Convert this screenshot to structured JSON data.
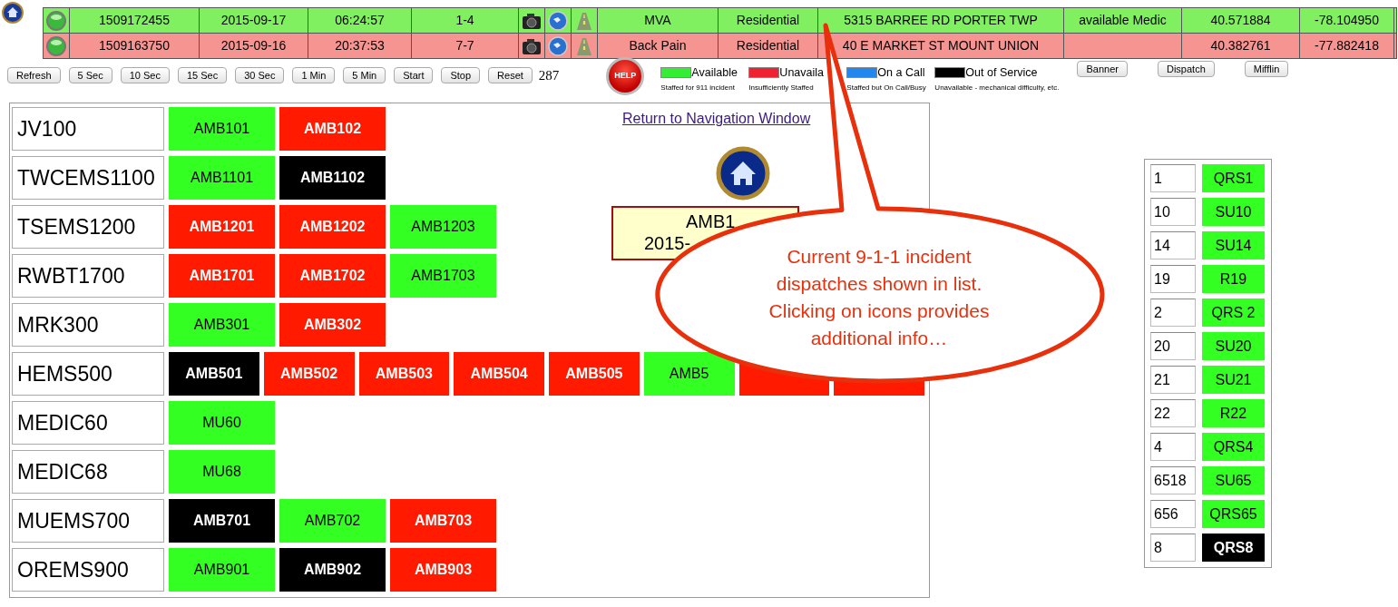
{
  "incidents": [
    {
      "id": "1509172455",
      "date": "2015-09-17",
      "time": "06:24:57",
      "code": "1-4",
      "type": "MVA",
      "category": "Residential",
      "address": "5315 BARREE RD PORTER TWP",
      "status": "available Medic",
      "latitude": "40.571884",
      "longitude": "-78.104950",
      "color": "#80f060"
    },
    {
      "id": "1509163750",
      "date": "2015-09-16",
      "time": "20:37:53",
      "code": "7-7",
      "type": "Back Pain",
      "category": "Residential",
      "address": "40 E MARKET ST MOUNT UNION",
      "latitude": "40.382761",
      "longitude": "-77.882418",
      "color": "#f59490"
    }
  ],
  "refresh_buttons": [
    "Refresh",
    "5 Sec",
    "10 Sec",
    "15 Sec",
    "30 Sec",
    "1 Min",
    "5 Min",
    "Start",
    "Stop",
    "Reset"
  ],
  "counter": "287",
  "help_button": "HELP",
  "legend": [
    {
      "label": "Available",
      "caption": "Staffed for 911 incident",
      "color": "#33ee33"
    },
    {
      "label": "Unavaila",
      "caption": "Insufficiently Staffed",
      "color": "#ee2233"
    },
    {
      "label": "On a Call",
      "caption": "Staffed but On Call/Busy",
      "color": "#2288ee"
    },
    {
      "label": "Out of Service",
      "caption": "Unavailable - mechanical difficulty, etc.",
      "color": "#000000"
    }
  ],
  "page_buttons": [
    "Banner",
    "Dispatch",
    "Mifflin"
  ],
  "nav_link": "Return to Navigation Window",
  "selected_unit": {
    "lines": [
      "AMB1",
      "2015-"
    ]
  },
  "agencies": [
    {
      "name": "JV100",
      "units": [
        {
          "label": "AMB101",
          "color": "#33ff22"
        },
        {
          "label": "AMB102",
          "color": "#ff1a00"
        }
      ]
    },
    {
      "name": "TWCEMS1100",
      "units": [
        {
          "label": "AMB1101",
          "color": "#33ff22"
        },
        {
          "label": "AMB1102",
          "color": "#000000"
        }
      ]
    },
    {
      "name": "TSEMS1200",
      "units": [
        {
          "label": "AMB1201",
          "color": "#ff1a00"
        },
        {
          "label": "AMB1202",
          "color": "#ff1a00"
        },
        {
          "label": "AMB1203",
          "color": "#33ff22"
        }
      ]
    },
    {
      "name": "RWBT1700",
      "units": [
        {
          "label": "AMB1701",
          "color": "#ff1a00"
        },
        {
          "label": "AMB1702",
          "color": "#ff1a00"
        },
        {
          "label": "AMB1703",
          "color": "#33ff22"
        }
      ]
    },
    {
      "name": "MRK300",
      "units": [
        {
          "label": "AMB301",
          "color": "#33ff22"
        },
        {
          "label": "AMB302",
          "color": "#ff1a00"
        }
      ]
    },
    {
      "name": "HEMS500",
      "units": [
        {
          "label": "AMB501",
          "color": "#000000"
        },
        {
          "label": "AMB502",
          "color": "#ff1a00"
        },
        {
          "label": "AMB503",
          "color": "#ff1a00"
        },
        {
          "label": "AMB504",
          "color": "#ff1a00"
        },
        {
          "label": "AMB505",
          "color": "#ff1a00"
        },
        {
          "label": "AMB5",
          "color": "#33ff22"
        },
        {
          "color": "#ff1a00"
        },
        {
          "color": "#ff1a00"
        }
      ]
    },
    {
      "name": "MEDIC60",
      "units": [
        {
          "label": "MU60",
          "color": "#33ff22"
        }
      ]
    },
    {
      "name": "MEDIC68",
      "units": [
        {
          "label": "MU68",
          "color": "#33ff22"
        }
      ]
    },
    {
      "name": "MUEMS700",
      "units": [
        {
          "label": "AMB701",
          "color": "#000000"
        },
        {
          "label": "AMB702",
          "color": "#33ff22"
        },
        {
          "label": "AMB703",
          "color": "#ff1a00"
        }
      ]
    },
    {
      "name": "OREMS900",
      "units": [
        {
          "label": "AMB901",
          "color": "#33ff22"
        },
        {
          "label": "AMB902",
          "color": "#000000"
        },
        {
          "label": "AMB903",
          "color": "#ff1a00"
        }
      ]
    }
  ],
  "quick_response": [
    {
      "number": "1",
      "unit": "QRS1",
      "color": "#33ff22"
    },
    {
      "number": "10",
      "unit": "SU10",
      "color": "#33ff22"
    },
    {
      "number": "14",
      "unit": "SU14",
      "color": "#33ff22"
    },
    {
      "number": "19",
      "unit": "R19",
      "color": "#33ff22"
    },
    {
      "number": "2",
      "unit": "QRS 2",
      "color": "#33ff22"
    },
    {
      "number": "20",
      "unit": "SU20",
      "color": "#33ff22"
    },
    {
      "number": "21",
      "unit": "SU21",
      "color": "#33ff22"
    },
    {
      "number": "22",
      "unit": "R22",
      "color": "#33ff22"
    },
    {
      "number": "4",
      "unit": "QRS4",
      "color": "#33ff22"
    },
    {
      "number": "6518",
      "unit": "SU65",
      "color": "#33ff22"
    },
    {
      "number": "656",
      "unit": "QRS65",
      "color": "#33ff22"
    },
    {
      "number": "8",
      "unit": "QRS8",
      "color": "#000000"
    }
  ],
  "callout": {
    "text": "Current 9-1-1 incident dispatches shown in list. Clicking on icons provides additional info…"
  }
}
